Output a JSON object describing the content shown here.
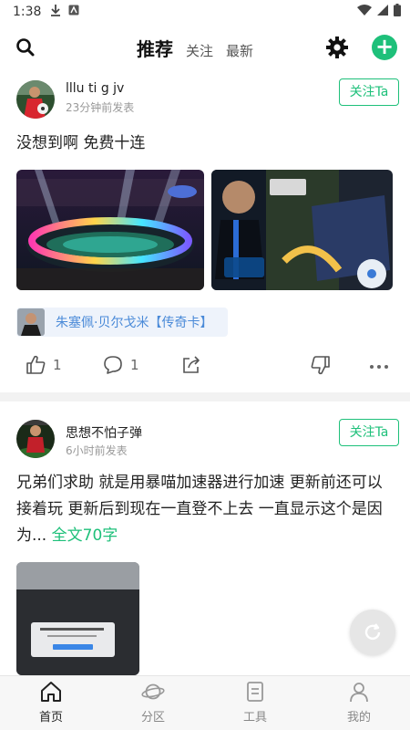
{
  "status_bar": {
    "time": "1:38"
  },
  "header": {
    "tabs": [
      {
        "label": "推荐",
        "active": true
      },
      {
        "label": "关注",
        "active": false
      },
      {
        "label": "最新",
        "active": false
      }
    ],
    "plus_label": "+"
  },
  "posts": [
    {
      "username": "lllu ti g jv",
      "time": "23分钟前发表",
      "follow_label": "关注Ta",
      "text": "没想到啊 免费十连",
      "tag": "朱塞佩·贝尔戈米【传奇卡】",
      "like_count": "1",
      "comment_count": "1"
    },
    {
      "username": "思想不怕子弹",
      "time": "6小时前发表",
      "follow_label": "关注Ta",
      "text": "兄弟们求助  就是用暴喵加速器进行加速  更新前还可以接着玩  更新后到现在一直登不上去  一直显示这个是因为...",
      "more_label": "全文70字"
    }
  ],
  "bottom_nav": [
    {
      "label": "首页",
      "icon": "home-icon",
      "active": true
    },
    {
      "label": "分区",
      "icon": "planet-icon",
      "active": false
    },
    {
      "label": "工具",
      "icon": "tools-icon",
      "active": false
    },
    {
      "label": "我的",
      "icon": "profile-icon",
      "active": false
    }
  ],
  "colors": {
    "accent": "#1ec07a",
    "tag_text": "#4a8ad8"
  }
}
